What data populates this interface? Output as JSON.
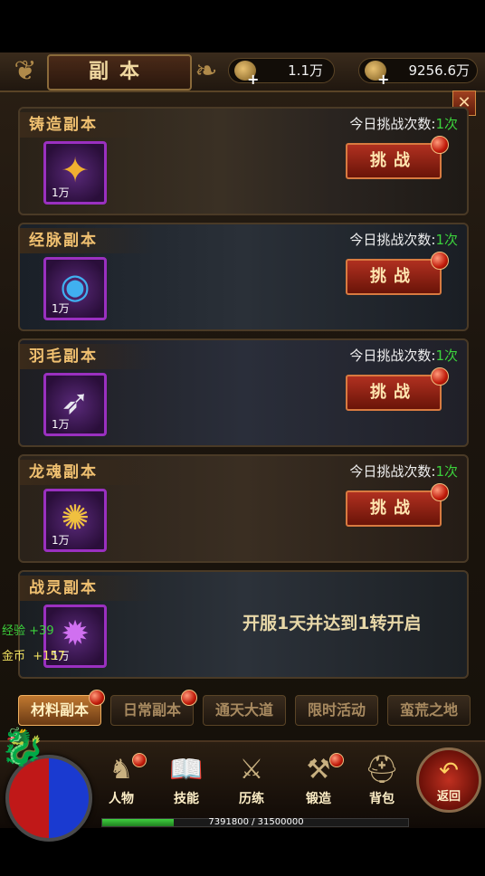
{
  "header": {
    "title": "副本",
    "currencies": [
      {
        "icon": "coin-key-icon",
        "value": "1.1万"
      },
      {
        "icon": "gold-ingot-icon",
        "value": "9256.6万"
      }
    ]
  },
  "dungeons": [
    {
      "name": "铸造副本",
      "item_icon": "crystal-icon",
      "item_qty": "1万",
      "count_label": "今日挑战次数:",
      "count_value": "1次",
      "button": "挑战"
    },
    {
      "name": "经脉副本",
      "item_icon": "blue-orb-icon",
      "item_qty": "1万",
      "count_label": "今日挑战次数:",
      "count_value": "1次",
      "button": "挑战"
    },
    {
      "name": "羽毛副本",
      "item_icon": "feather-icon",
      "item_qty": "1万",
      "count_label": "今日挑战次数:",
      "count_value": "1次",
      "button": "挑战"
    },
    {
      "name": "龙魂副本",
      "item_icon": "dragon-soul-icon",
      "item_qty": "1万",
      "count_label": "今日挑战次数:",
      "count_value": "1次",
      "button": "挑战"
    },
    {
      "name": "战灵副本",
      "item_icon": "purple-spirit-icon",
      "item_qty": "1万",
      "locked_text": "开服1天并达到1转开启"
    }
  ],
  "rewards": [
    {
      "label": "经验",
      "value": "+39"
    },
    {
      "label": "金币",
      "value": "+157"
    }
  ],
  "tabs": [
    "材料副本",
    "日常副本",
    "通天大道",
    "限时活动",
    "蛮荒之地"
  ],
  "active_tab": 0,
  "nav": [
    {
      "label": "人物",
      "icon": "character-icon"
    },
    {
      "label": "技能",
      "icon": "skill-book-icon"
    },
    {
      "label": "历练",
      "icon": "training-icon"
    },
    {
      "label": "锻造",
      "icon": "anvil-icon"
    },
    {
      "label": "背包",
      "icon": "backpack-icon"
    }
  ],
  "back_label": "返回",
  "exp": {
    "text": "7391800 / 31500000",
    "fraction": 0.235
  }
}
